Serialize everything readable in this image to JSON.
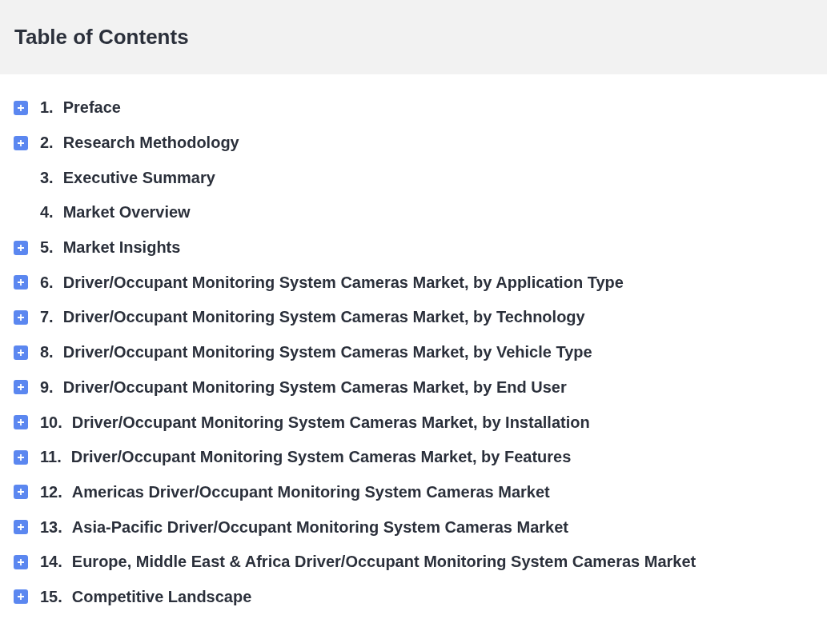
{
  "header": {
    "title": "Table of Contents"
  },
  "items": [
    {
      "number": "1.",
      "title": "Preface",
      "expandable": true
    },
    {
      "number": "2.",
      "title": "Research Methodology",
      "expandable": true
    },
    {
      "number": "3.",
      "title": "Executive Summary",
      "expandable": false
    },
    {
      "number": "4.",
      "title": "Market Overview",
      "expandable": false
    },
    {
      "number": "5.",
      "title": "Market Insights",
      "expandable": true
    },
    {
      "number": "6.",
      "title": "Driver/Occupant Monitoring System Cameras Market, by Application Type",
      "expandable": true
    },
    {
      "number": "7.",
      "title": "Driver/Occupant Monitoring System Cameras Market, by Technology",
      "expandable": true
    },
    {
      "number": "8.",
      "title": "Driver/Occupant Monitoring System Cameras Market, by Vehicle Type",
      "expandable": true
    },
    {
      "number": "9.",
      "title": "Driver/Occupant Monitoring System Cameras Market, by End User",
      "expandable": true
    },
    {
      "number": "10.",
      "title": "Driver/Occupant Monitoring System Cameras Market, by Installation",
      "expandable": true
    },
    {
      "number": "11.",
      "title": "Driver/Occupant Monitoring System Cameras Market, by Features",
      "expandable": true
    },
    {
      "number": "12.",
      "title": "Americas Driver/Occupant Monitoring System Cameras Market",
      "expandable": true
    },
    {
      "number": "13.",
      "title": "Asia-Pacific Driver/Occupant Monitoring System Cameras Market",
      "expandable": true
    },
    {
      "number": "14.",
      "title": "Europe, Middle East & Africa Driver/Occupant Monitoring System Cameras Market",
      "expandable": true
    },
    {
      "number": "15.",
      "title": "Competitive Landscape",
      "expandable": true
    }
  ]
}
